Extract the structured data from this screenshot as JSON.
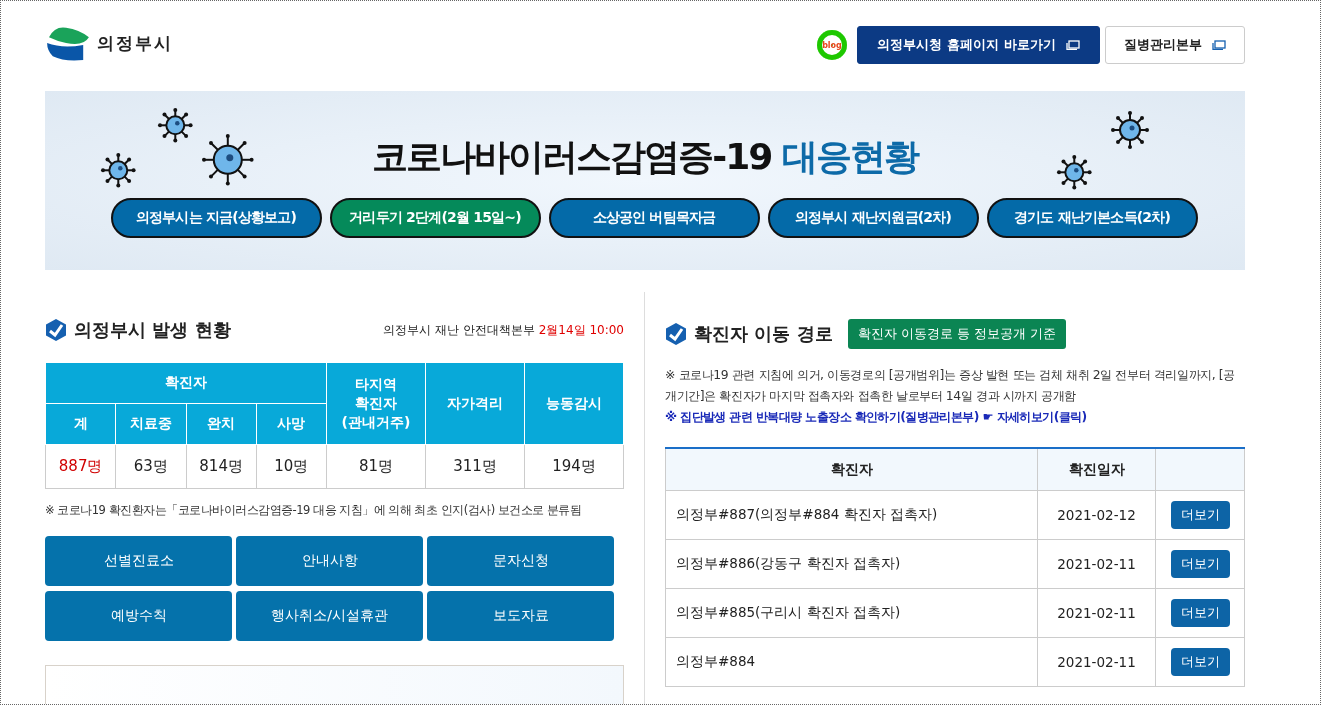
{
  "header": {
    "logo_text": "의정부시",
    "blog_label": "blog",
    "links": [
      {
        "label": "의정부시청 홈페이지 바로가기",
        "kind": "primary"
      },
      {
        "label": "질병관리본부",
        "kind": "outline"
      }
    ]
  },
  "banner": {
    "title": "코로나바이러스감염증-19",
    "title_highlight": "대응현황",
    "buttons": [
      {
        "label": "의정부시는 지금(상황보고)",
        "color": "#046aa8"
      },
      {
        "label": "거리두기 2단계(2월 15일~)",
        "color": "#058a5a"
      },
      {
        "label": "소상공인 버팀목자금",
        "color": "#046aa8"
      },
      {
        "label": "의정부시 재난지원금(2차)",
        "color": "#046aa8"
      },
      {
        "label": "경기도 재난기본소득(2차)",
        "color": "#046aa8"
      }
    ]
  },
  "status": {
    "title": "의정부시 발생 현황",
    "source": "의정부시 재난 안전대책본부",
    "time": "2월14일 10:00",
    "group_header": "확진자",
    "columns": [
      "계",
      "치료중",
      "완치",
      "사망"
    ],
    "other_columns": [
      "타지역\n확진자\n(관내거주)",
      "자가격리",
      "능동감시"
    ],
    "values": [
      {
        "text": "887명",
        "highlight": true
      },
      {
        "text": "63명",
        "highlight": false
      },
      {
        "text": "814명",
        "highlight": false
      },
      {
        "text": "10명",
        "highlight": false
      },
      {
        "text": "81명",
        "highlight": false
      },
      {
        "text": "311명",
        "highlight": false
      },
      {
        "text": "194명",
        "highlight": false
      }
    ],
    "footnote": "※ 코로나19 확진환자는「코로나바이러스감염증-19 대응 지침」에 의해 최초 인지(검사) 보건소로 분류됨",
    "menu": [
      "선별진료소",
      "안내사항",
      "문자신청",
      "예방수칙",
      "행사취소/시설휴관",
      "보도자료"
    ]
  },
  "route": {
    "title": "확진자 이동 경로",
    "badge": "확진자 이동경로 등 정보공개 기준",
    "note": "※ 코로나19 관련 지침에 의거, 이동경로의 [공개범위]는 증상 발현 또는 검체 채취 2일 전부터 격리일까지, [공개기간]은 확진자가 마지막 접촉자와 접촉한 날로부터 14일 경과 시까지 공개함",
    "link": "※ 집단발생 관련 반복대량 노출장소 확인하기(질병관리본부) ☛ 자세히보기(클릭)",
    "table": {
      "columns": [
        "확진자",
        "확진일자"
      ],
      "rows": [
        {
          "case": "의정부#887(의정부#884 확진자 접촉자)",
          "date": "2021-02-12",
          "action": "더보기"
        },
        {
          "case": "의정부#886(강동구 확진자 접촉자)",
          "date": "2021-02-11",
          "action": "더보기"
        },
        {
          "case": "의정부#885(구리시 확진자 접촉자)",
          "date": "2021-02-11",
          "action": "더보기"
        },
        {
          "case": "의정부#884",
          "date": "2021-02-11",
          "action": "더보기"
        }
      ]
    }
  }
}
